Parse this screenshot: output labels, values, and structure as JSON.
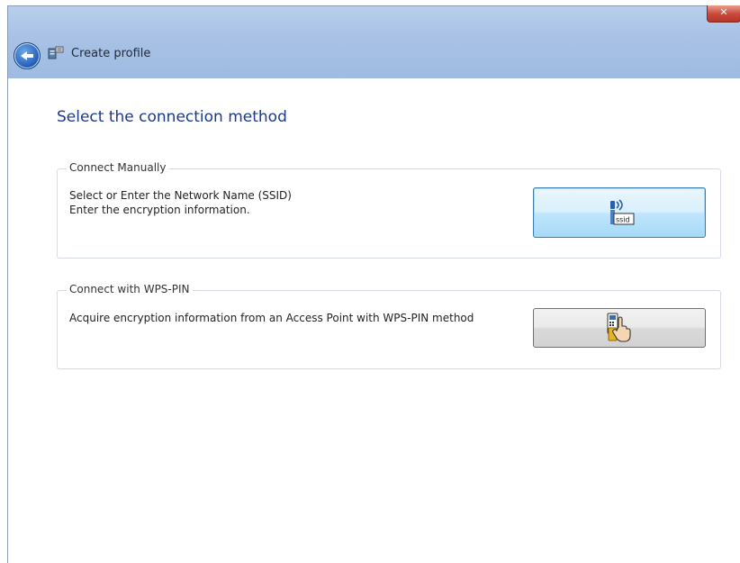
{
  "window": {
    "title": "Create profile"
  },
  "page": {
    "heading": "Select the connection method"
  },
  "manual_group": {
    "legend": "Connect Manually",
    "line1": "Select or Enter the Network Name (SSID)",
    "line2": "Enter the encryption information.",
    "button_icon_label": "ssid"
  },
  "wps_group": {
    "legend": "Connect with WPS-PIN",
    "description": "Acquire encryption information from an Access Point with WPS-PIN method"
  },
  "icons": {
    "close": "close-icon",
    "back": "back-arrow-icon",
    "title": "network-profile-icon",
    "ssid": "ssid-signal-icon",
    "wps": "wps-pin-hand-icon"
  },
  "colors": {
    "titlebar": "#a9c2e6",
    "heading": "#1b3a8a",
    "close_button": "#c9463a"
  }
}
